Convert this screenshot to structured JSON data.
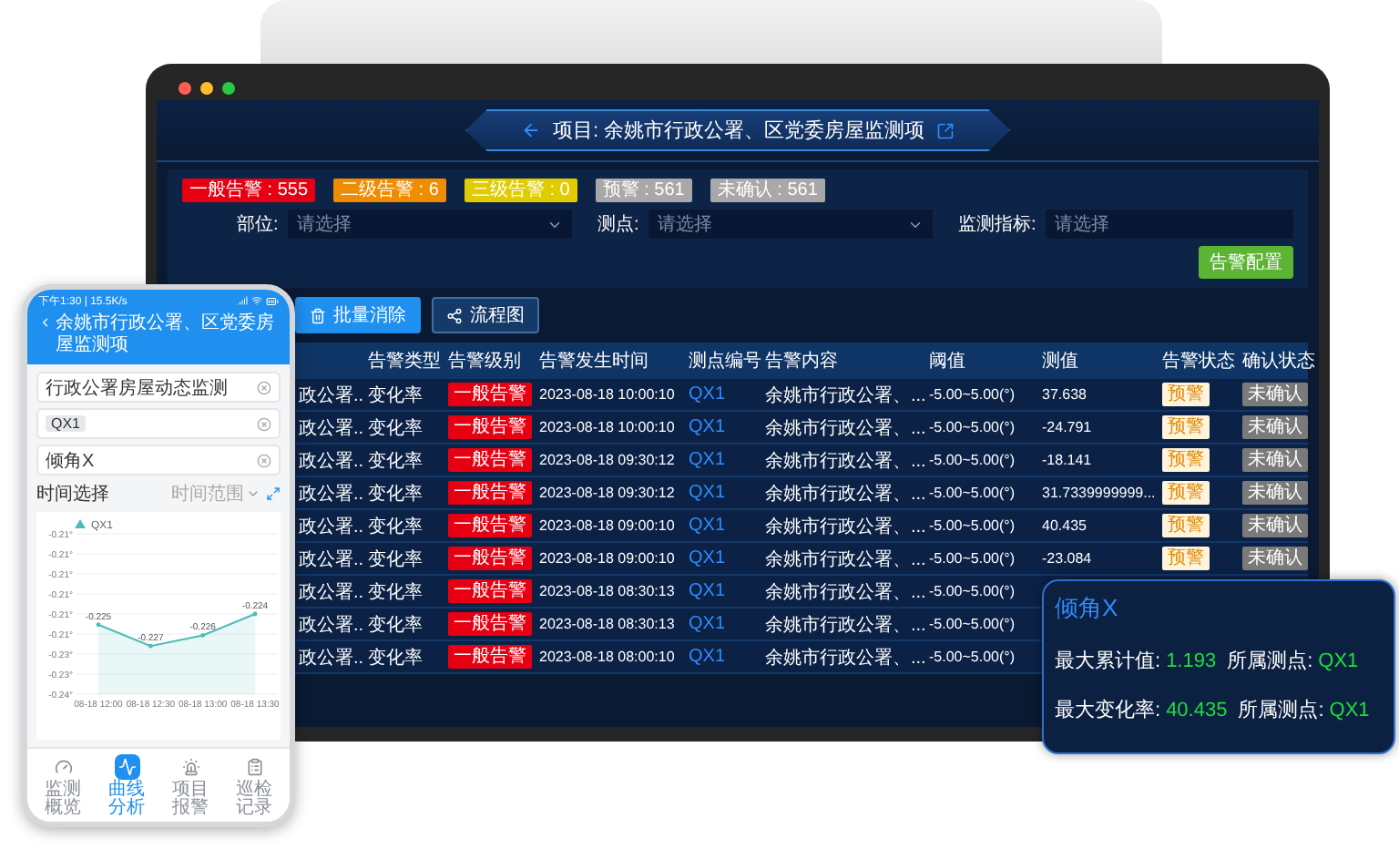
{
  "laptop": {
    "title": "项目: 余姚市行政公署、区党委房屋监测项",
    "alarm_counts": [
      {
        "label": "一般告警 : 555",
        "color": "#e60012"
      },
      {
        "label": "二级告警 : 6",
        "color": "#f08c00"
      },
      {
        "label": "三级告警 : 0",
        "color": "#e0cc00"
      },
      {
        "label": "预警 : 561",
        "color": "#a8a8a8"
      },
      {
        "label": "未确认 : 561",
        "color": "#a8a8a8"
      }
    ],
    "filters": [
      {
        "label": "部位:",
        "placeholder": "请选择",
        "kind": "select"
      },
      {
        "label": "测点:",
        "placeholder": "请选择",
        "kind": "select"
      },
      {
        "label": "监测指标:",
        "placeholder": "请选择",
        "kind": "input"
      }
    ],
    "config_button": "告警配置",
    "actions": [
      {
        "label": "批量消除",
        "kind": "primary"
      },
      {
        "label": "流程图",
        "kind": "secondary"
      }
    ],
    "table": {
      "columns": [
        "告警类型",
        "告警级别",
        "告警发生时间",
        "测点编号",
        "告警内容",
        "阈值",
        "测值",
        "告警状态",
        "确认状态"
      ],
      "rows": [
        {
          "column_1": "政公署..",
          "type": "变化率",
          "level": "一般告警",
          "time": "2023-08-18 10:00:10",
          "point": "QX1",
          "content": "余姚市行政公署、...",
          "threshold": "-5.00~5.00(°)",
          "value": "37.638",
          "status": "预警",
          "confirm": "未确认"
        },
        {
          "column_1": "政公署..",
          "type": "变化率",
          "level": "一般告警",
          "time": "2023-08-18 10:00:10",
          "point": "QX1",
          "content": "余姚市行政公署、...",
          "threshold": "-5.00~5.00(°)",
          "value": "-24.791",
          "status": "预警",
          "confirm": "未确认"
        },
        {
          "column_1": "政公署..",
          "type": "变化率",
          "level": "一般告警",
          "time": "2023-08-18 09:30:12",
          "point": "QX1",
          "content": "余姚市行政公署、...",
          "threshold": "-5.00~5.00(°)",
          "value": "-18.141",
          "status": "预警",
          "confirm": "未确认"
        },
        {
          "column_1": "政公署..",
          "type": "变化率",
          "level": "一般告警",
          "time": "2023-08-18 09:30:12",
          "point": "QX1",
          "content": "余姚市行政公署、...",
          "threshold": "-5.00~5.00(°)",
          "value": "31.7339999999...",
          "status": "预警",
          "confirm": "未确认"
        },
        {
          "column_1": "政公署..",
          "type": "变化率",
          "level": "一般告警",
          "time": "2023-08-18 09:00:10",
          "point": "QX1",
          "content": "余姚市行政公署、...",
          "threshold": "-5.00~5.00(°)",
          "value": "40.435",
          "status": "预警",
          "confirm": "未确认"
        },
        {
          "column_1": "政公署..",
          "type": "变化率",
          "level": "一般告警",
          "time": "2023-08-18 09:00:10",
          "point": "QX1",
          "content": "余姚市行政公署、...",
          "threshold": "-5.00~5.00(°)",
          "value": "-23.084",
          "status": "预警",
          "confirm": "未确认"
        },
        {
          "column_1": "政公署..",
          "type": "变化率",
          "level": "一般告警",
          "time": "2023-08-18 08:30:13",
          "point": "QX1",
          "content": "余姚市行政公署、...",
          "threshold": "-5.00~5.00(°)"
        },
        {
          "column_1": "政公署..",
          "type": "变化率",
          "level": "一般告警",
          "time": "2023-08-18 08:30:13",
          "point": "QX1",
          "content": "余姚市行政公署、...",
          "threshold": "-5.00~5.00(°)"
        },
        {
          "column_1": "政公署..",
          "type": "变化率",
          "level": "一般告警",
          "time": "2023-08-18 08:00:10",
          "point": "QX1",
          "content": "余姚市行政公署、...",
          "threshold": "-5.00~5.00(°)"
        }
      ]
    }
  },
  "phone": {
    "status_time": "下午1:30 | 15.5K/s",
    "title": "余姚市行政公署、区党委房屋监测项",
    "fields": [
      {
        "kind": "text",
        "value": "行政公署房屋动态监测"
      },
      {
        "kind": "tag",
        "value": "QX1"
      },
      {
        "kind": "text",
        "value": "倾角X"
      }
    ],
    "time_label": "时间选择",
    "time_range": {
      "placeholder": "时间范围"
    },
    "chart_data": {
      "type": "area",
      "categories": [
        "08-18 12:00",
        "08-18 12:30",
        "08-18 13:00",
        "08-18 13:30"
      ],
      "series": [
        {
          "name": "QX1",
          "color": "#4cbcb8",
          "values": [
            -0.225,
            -0.227,
            -0.226,
            -0.224
          ]
        }
      ],
      "grid": true,
      "data_labels": true
    },
    "chart_y_labels": [
      "-0.21°",
      "-0.21°",
      "-0.21°",
      "-0.21°",
      "-0.21°",
      "-0.21°",
      "-0.23°",
      "-0.23°",
      "-0.24°"
    ],
    "nav": [
      {
        "label": "监测概览",
        "selected": false
      },
      {
        "label": "曲线分析",
        "selected": true
      },
      {
        "label": "项目报警",
        "selected": false
      },
      {
        "label": "巡检记录",
        "selected": false
      }
    ]
  },
  "card": {
    "title": "倾角X",
    "rows": [
      {
        "items": [
          {
            "label": "最大累计值:",
            "value": "1.193"
          },
          {
            "label": "所属测点:",
            "value": "QX1"
          }
        ]
      },
      {
        "items": [
          {
            "label": "最大变化率:",
            "value": "40.435"
          },
          {
            "label": "所属测点:",
            "value": "QX1"
          }
        ]
      }
    ]
  }
}
